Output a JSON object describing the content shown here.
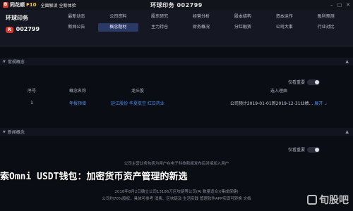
{
  "app": {
    "logo_mark": "B",
    "logo_text": "同花顺",
    "logo_suffix": "F10",
    "subtitle": "全面解读 全新体验",
    "window_title": "环球印务 002799"
  },
  "stock": {
    "name": "环球印务",
    "badge": "R",
    "code": "002799"
  },
  "nav": {
    "row1": [
      "最新动态",
      "公司资料",
      "股东研究",
      "经营分析",
      "股本结构",
      "资本运作",
      "盈利预测"
    ],
    "row2": [
      "新闻公告",
      "概念题材",
      "主力持仓",
      "财务概况",
      "分红融资",
      "公司大事",
      "行业对比"
    ],
    "active_index_row2": 1
  },
  "panels": {
    "concept": {
      "title": "常规概念",
      "toggle_label": "仅看重要",
      "columns": [
        "序号",
        "概念名称",
        "龙头股",
        "",
        "选入理由"
      ],
      "rows": [
        {
          "index": "1",
          "name": "年报预增",
          "leaders": "延江股份 华夏航空 红日药业",
          "reason": "公司预计2019-01-01到2019-12-31业绩...",
          "more": "展开"
        }
      ]
    },
    "news": {
      "title": "新闻概念",
      "toggle_label": "仅看重要"
    }
  },
  "news_lines": [
    "公司主营业务包括为用户在电子科技新闻发布后对接加入用户",
    "2018年8月2日确立公司13186万区块链等公司(AI 数量适合)(集成保健)",
    "公司约70%股权，具体可参考 消费、区块链及 生活实践 管理软件APP实现可转换 文档"
  ],
  "overlay": {
    "headline": "索Omni USDT钱包：加密货币资产管理的新选"
  },
  "watermark": {
    "text": "旬股吧"
  },
  "colors": {
    "accent": "#2a3a66",
    "link": "#4d8ff0",
    "brand_red": "#d23b2f"
  }
}
